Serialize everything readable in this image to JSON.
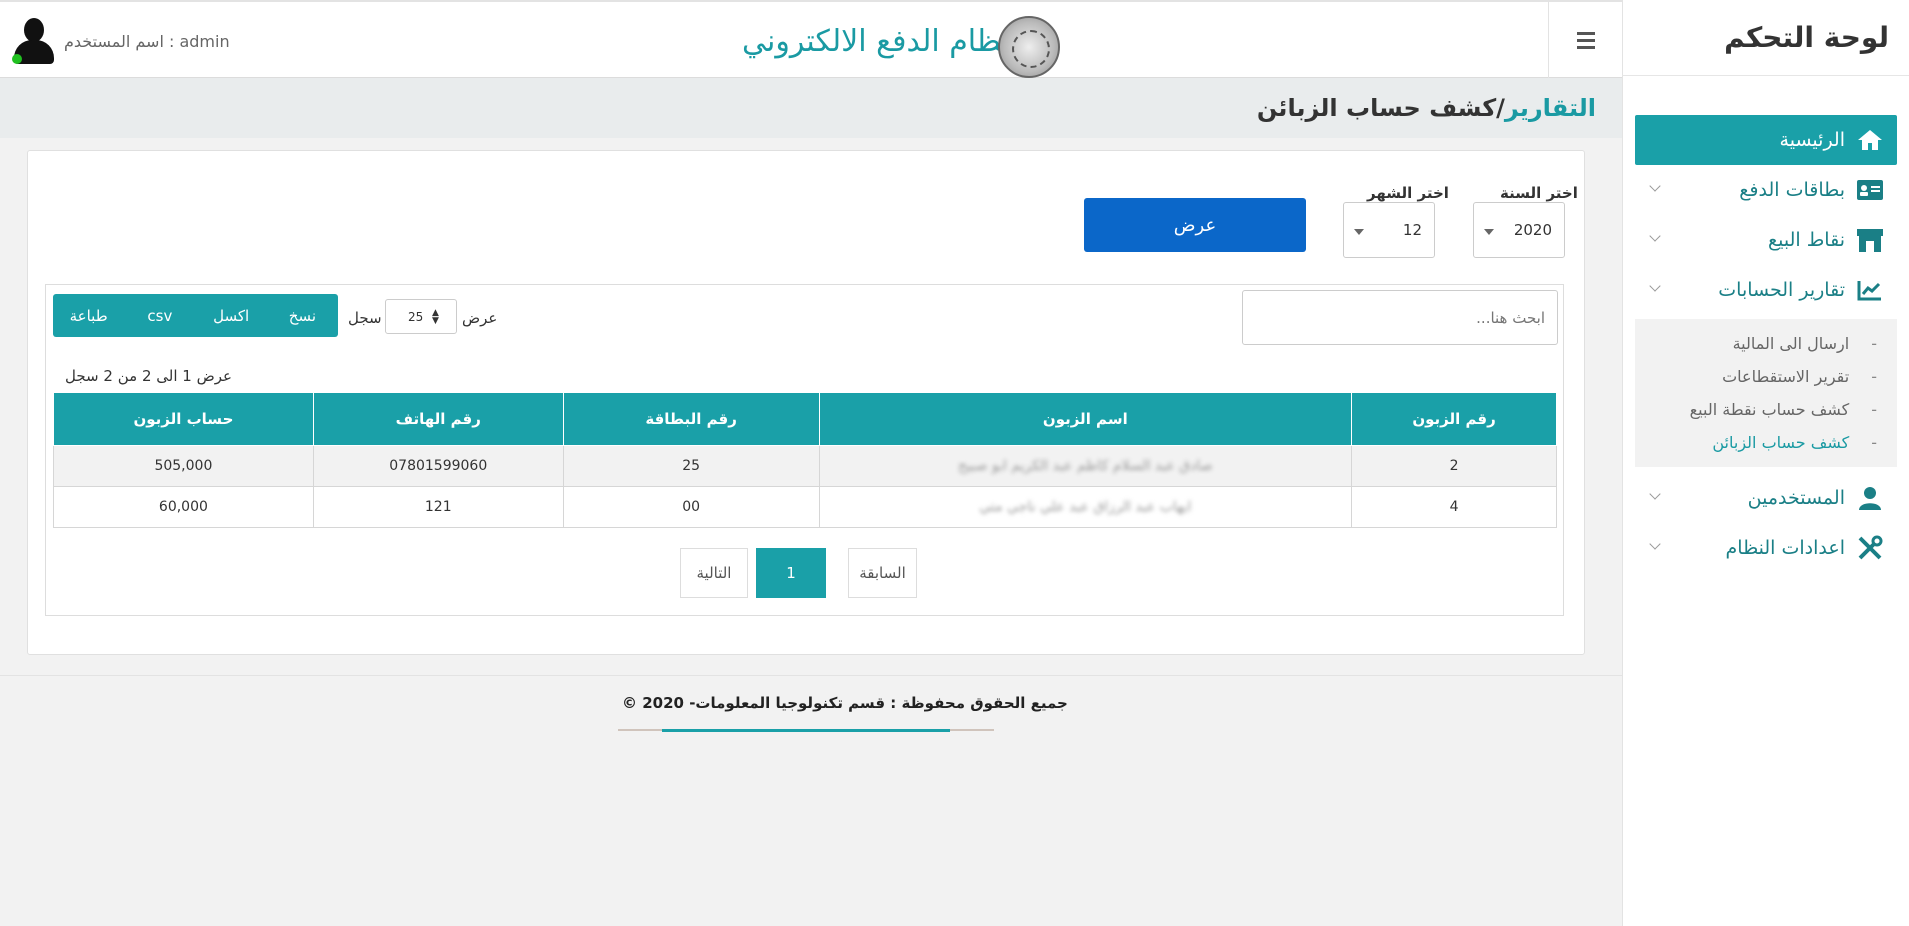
{
  "sidebar": {
    "title": "لوحة التحكم",
    "items": [
      {
        "label": "الرئيسية",
        "icon": "home-icon",
        "active": true
      },
      {
        "label": "بطاقات الدفع",
        "icon": "id-card-icon"
      },
      {
        "label": "نقاط البيع",
        "icon": "store-icon"
      },
      {
        "label": "تقارير الحسابات",
        "icon": "chart-line-icon"
      }
    ],
    "sub_items": [
      {
        "label": "ارسال الى المالية"
      },
      {
        "label": "تقرير الاستقطاعات"
      },
      {
        "label": "كشف حساب نقطة البيع"
      },
      {
        "label": "كشف حساب الزبائن",
        "current": true
      }
    ],
    "items_after": [
      {
        "label": "المستخدمين",
        "icon": "users-icon"
      },
      {
        "label": "اعدادات النظام",
        "icon": "tools-icon"
      }
    ]
  },
  "header": {
    "app_title": "نظام الدفع الالكتروني",
    "user_label": "اسم المستخدم : admin"
  },
  "breadcrumb": {
    "section": "التقارير",
    "separator": " /",
    "page": "كشف حساب الزبائن"
  },
  "filters": {
    "year_label": "اختر السنة",
    "year_value": "2020",
    "month_label": "اختر الشهر",
    "month_value": "12",
    "show_button": "عرض"
  },
  "table_controls": {
    "search_placeholder": "ابحث هنا...",
    "length_prefix": "عرض",
    "length_value": "25",
    "length_suffix": "سجل",
    "buttons": [
      "نسخ",
      "اكسل",
      "csv",
      "طباعة"
    ],
    "info": "عرض 1 الى 2 من 2 سجل"
  },
  "table": {
    "columns": [
      "رقم الزبون",
      "اسم الزبون",
      "رقم البطاقة",
      "رقم الهاتف",
      "حساب الزبون"
    ],
    "rows": [
      {
        "customer_no": "2",
        "customer_name": "صادق عبد السلام كاظم عبد الكريم ابو صبيح",
        "card_no": "25",
        "phone": "07801599060",
        "balance": "505,000"
      },
      {
        "customer_no": "4",
        "customer_name": "ايهاب عبد الرزاق عبد علي ناجي متي",
        "card_no": "00",
        "phone": "121",
        "balance": "60,000"
      }
    ]
  },
  "pagination": {
    "previous": "السابقة",
    "current": "1",
    "next": "التالية"
  },
  "footer": {
    "text": "© 2020 -جميع الحقوق محفوظة : قسم تكنولوجيا المعلومات"
  },
  "colors": {
    "accent": "#1aa0a8",
    "primary_button": "#0b67c9",
    "negative": "#d12020"
  }
}
